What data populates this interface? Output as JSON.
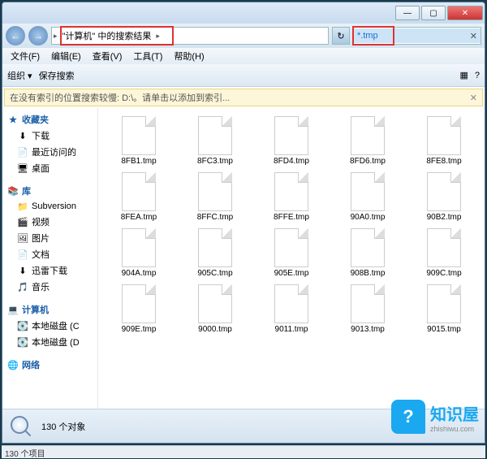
{
  "titlebar": {
    "min": "—",
    "max": "▢",
    "close": "✕"
  },
  "nav": {
    "back": "←",
    "fwd": "→"
  },
  "address": {
    "crumb1": "\"计算机\" 中的搜索结果",
    "arrow": "▸"
  },
  "search": {
    "value": "*.tmp",
    "clear": "✕"
  },
  "menu": {
    "file": "文件(F)",
    "edit": "编辑(E)",
    "view": "查看(V)",
    "tools": "工具(T)",
    "help": "帮助(H)"
  },
  "toolbar": {
    "org": "组织 ▾",
    "save": "保存搜索",
    "burn_icon": "🔥",
    "view_icon": "▦",
    "help_icon": "?"
  },
  "infobar": {
    "text": "在没有索引的位置搜索较慢: D:\\。请单击以添加到索引...",
    "close": "✕"
  },
  "sidebar": {
    "fav": {
      "hd": "收藏夹",
      "icon": "★",
      "items": [
        "下载",
        "最近访问的",
        "桌面"
      ],
      "icons": [
        "⬇",
        "📄",
        "🖥"
      ]
    },
    "lib": {
      "hd": "库",
      "icon": "📚",
      "items": [
        "Subversion",
        "视频",
        "图片",
        "文档",
        "迅雷下载",
        "音乐"
      ],
      "icons": [
        "📁",
        "🎬",
        "🖼",
        "📄",
        "⬇",
        "🎵"
      ]
    },
    "comp": {
      "hd": "计算机",
      "icon": "💻",
      "items": [
        "本地磁盘 (C",
        "本地磁盘 (D"
      ],
      "icons": [
        "💽",
        "💽"
      ]
    },
    "net": {
      "hd": "网络",
      "icon": "🌐"
    }
  },
  "files": [
    "8FB1.tmp",
    "8FC3.tmp",
    "8FD4.tmp",
    "8FD6.tmp",
    "8FE8.tmp",
    "8FEA.tmp",
    "8FFC.tmp",
    "8FFE.tmp",
    "90A0.tmp",
    "90B2.tmp",
    "904A.tmp",
    "905C.tmp",
    "905E.tmp",
    "908B.tmp",
    "909C.tmp",
    "909E.tmp",
    "9000.tmp",
    "9011.tmp",
    "9013.tmp",
    "9015.tmp"
  ],
  "status": {
    "count": "130 个对象",
    "items": "130 个项目"
  },
  "watermark": {
    "bubble": "?",
    "t1": "知识屋",
    "t2": "zhishiwu.com"
  }
}
